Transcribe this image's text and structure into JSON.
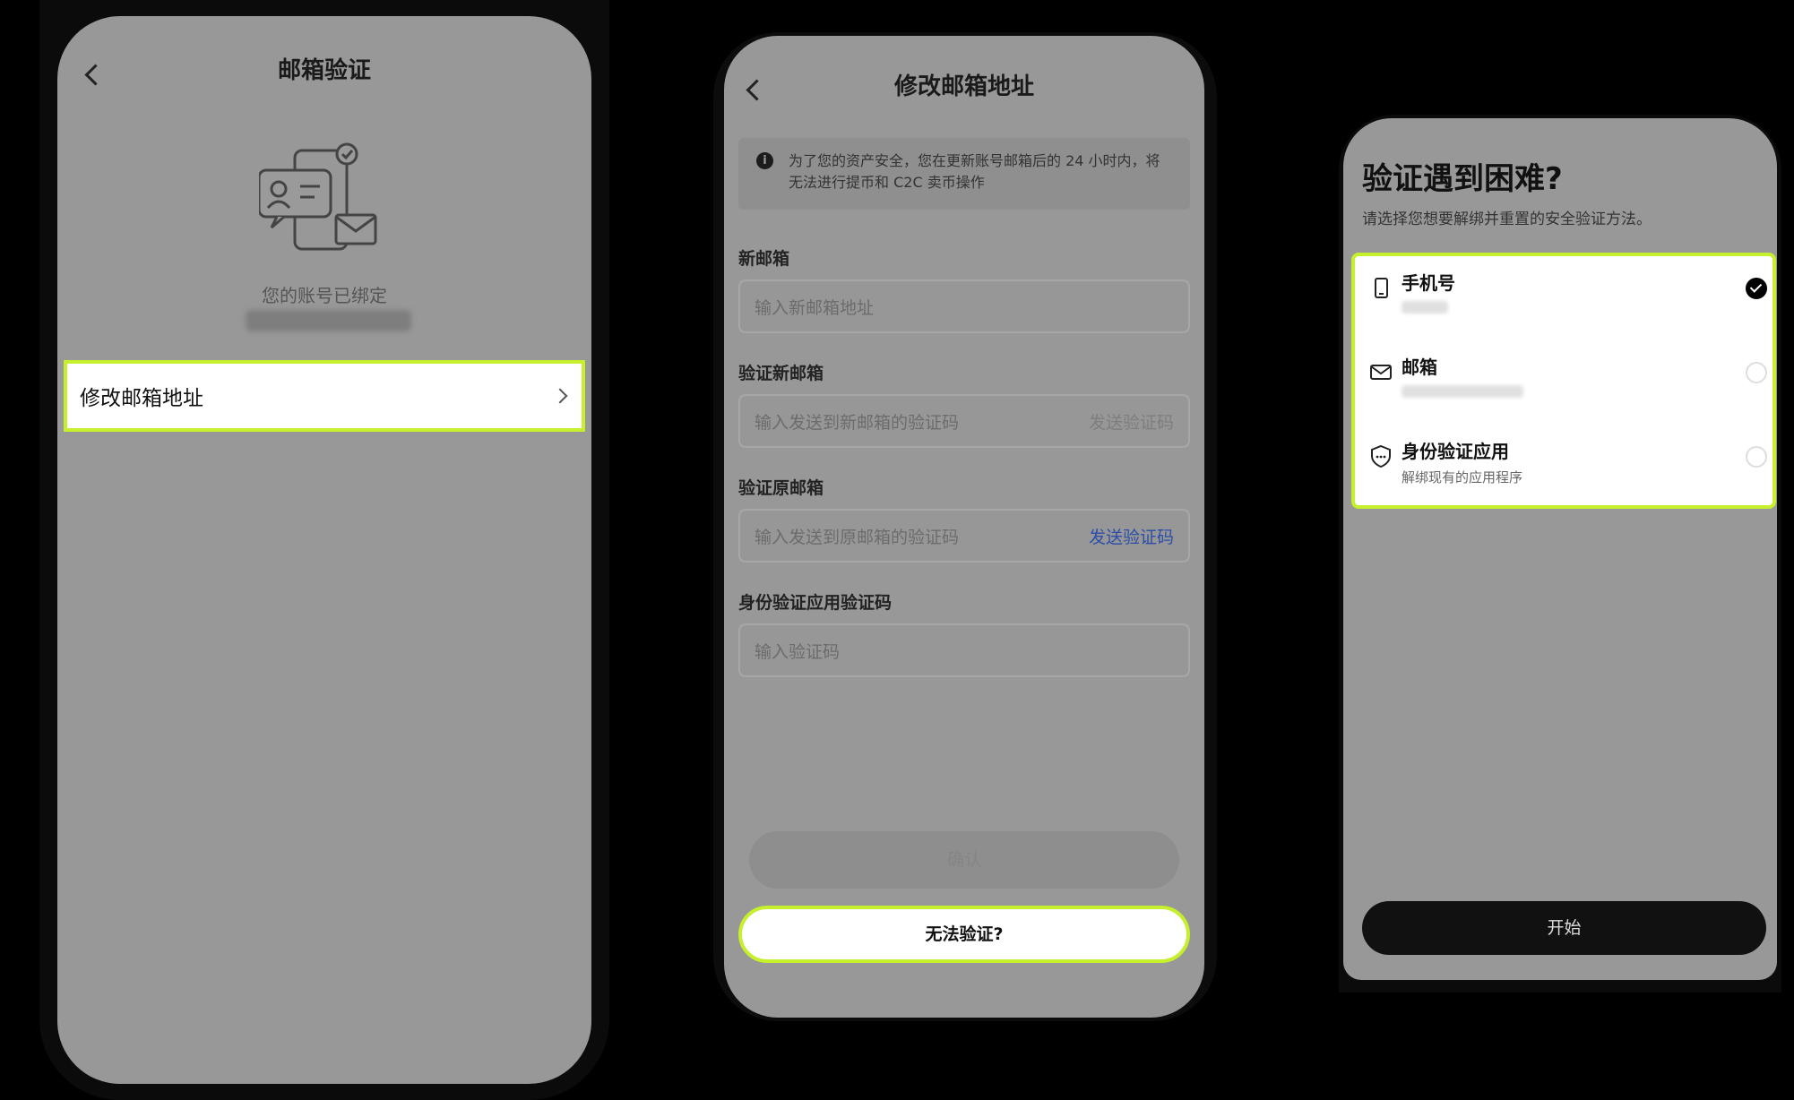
{
  "screen1": {
    "title": "邮箱验证",
    "bound_text": "您的账号已绑定",
    "menu_item_label": "修改邮箱地址"
  },
  "screen2": {
    "title": "修改邮箱地址",
    "notice": "为了您的资产安全，您在更新账号邮箱后的 24 小时内，将无法进行提币和 C2C 卖币操作",
    "new_email": {
      "label": "新邮箱",
      "placeholder": "输入新邮箱地址"
    },
    "verify_new": {
      "label": "验证新邮箱",
      "placeholder": "输入发送到新邮箱的验证码",
      "action": "发送验证码"
    },
    "verify_old": {
      "label": "验证原邮箱",
      "placeholder": "输入发送到原邮箱的验证码",
      "action": "发送验证码"
    },
    "auth_code": {
      "label": "身份验证应用验证码",
      "placeholder": "输入验证码"
    },
    "confirm_label": "确认",
    "cant_verify_label": "无法验证?"
  },
  "screen3": {
    "title": "验证遇到困难?",
    "subtitle": "请选择您想要解绑并重置的安全验证方法。",
    "options": [
      {
        "label": "手机号",
        "icon": "phone-icon",
        "selected": true
      },
      {
        "label": "邮箱",
        "icon": "mail-icon",
        "selected": false
      },
      {
        "label": "身份验证应用",
        "sub": "解绑现有的应用程序",
        "icon": "shield-icon",
        "selected": false
      }
    ],
    "start_label": "开始"
  },
  "colors": {
    "highlight": "#c6ef2c",
    "link_blue": "#2c4ea8",
    "dim_overlay": "#989898"
  }
}
